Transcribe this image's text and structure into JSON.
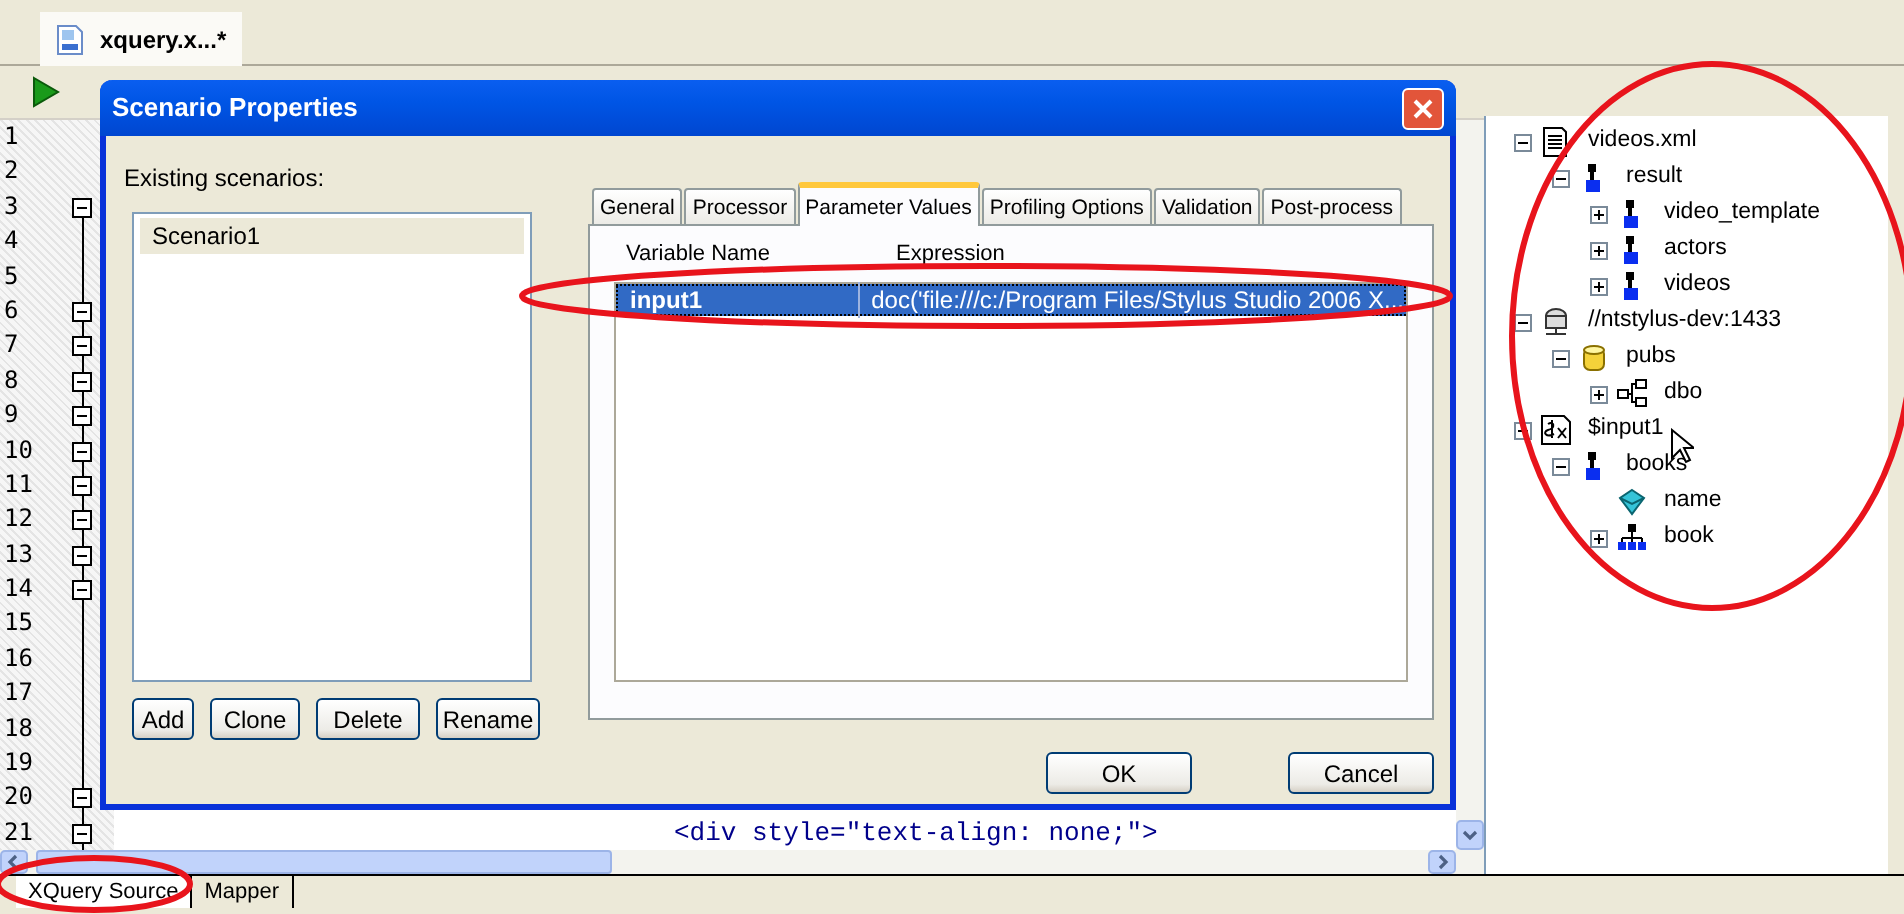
{
  "document_tab": {
    "label": "xquery.x...*",
    "selected": true
  },
  "gutter": [
    {
      "number": "1",
      "fold": false
    },
    {
      "number": "2",
      "fold": false
    },
    {
      "number": "3",
      "fold": true
    },
    {
      "number": "4",
      "fold": false
    },
    {
      "number": "5",
      "fold": false
    },
    {
      "number": "6",
      "fold": true
    },
    {
      "number": "7",
      "fold": true
    },
    {
      "number": "8",
      "fold": true
    },
    {
      "number": "9",
      "fold": true
    },
    {
      "number": "10",
      "fold": true
    },
    {
      "number": "11",
      "fold": true
    },
    {
      "number": "12",
      "fold": true
    },
    {
      "number": "13",
      "fold": true
    },
    {
      "number": "14",
      "fold": true
    },
    {
      "number": "15",
      "fold": false
    },
    {
      "number": "16",
      "fold": false
    },
    {
      "number": "17",
      "fold": false
    },
    {
      "number": "18",
      "fold": false
    },
    {
      "number": "19",
      "fold": false
    },
    {
      "number": "20",
      "fold": true
    },
    {
      "number": "21",
      "fold": true,
      "code": "<div style=\"text-align: none;\">"
    }
  ],
  "dialog": {
    "title": "Scenario Properties",
    "scenarios_label": "Existing scenarios:",
    "scenarios": [
      {
        "label": "Scenario1",
        "selected": true
      }
    ],
    "scenario_buttons": [
      "Add",
      "Clone",
      "Delete",
      "Rename"
    ],
    "tabs": [
      {
        "label": "General",
        "selected": false
      },
      {
        "label": "Processor",
        "selected": false
      },
      {
        "label": "Parameter Values",
        "selected": true
      },
      {
        "label": "Profiling Options",
        "selected": false
      },
      {
        "label": "Validation",
        "selected": false
      },
      {
        "label": "Post-process",
        "selected": false
      }
    ],
    "table": {
      "columns": [
        "Variable Name",
        "Expression"
      ],
      "rows": [
        {
          "cells": [
            "input1",
            "doc('file:///c:/Program Files/Stylus Studio 2006 X..."
          ],
          "selected": true
        }
      ]
    },
    "buttons": [
      "OK",
      "Cancel"
    ]
  },
  "tree": [
    {
      "label": "videos.xml",
      "kind": "file",
      "expanded": true,
      "children": [
        {
          "label": "result",
          "kind": "element",
          "expanded": true,
          "children": [
            {
              "label": "video_template",
              "kind": "element",
              "expanded": false
            },
            {
              "label": "actors",
              "kind": "element",
              "expanded": false
            },
            {
              "label": "videos",
              "kind": "element",
              "expanded": false
            }
          ]
        }
      ]
    },
    {
      "label": "//ntstylus-dev:1433",
      "kind": "server",
      "expanded": true,
      "children": [
        {
          "label": "pubs",
          "kind": "database",
          "expanded": true,
          "children": [
            {
              "label": "dbo",
              "kind": "schema",
              "expanded": false
            }
          ]
        }
      ]
    },
    {
      "label": "$input1",
      "kind": "variable",
      "expanded": true,
      "children": [
        {
          "label": "books",
          "kind": "element",
          "expanded": true,
          "children": [
            {
              "label": "name",
              "kind": "attribute"
            },
            {
              "label": "book",
              "kind": "group",
              "expanded": false
            }
          ]
        }
      ]
    }
  ],
  "bottom_tabs": [
    {
      "label": "XQuery Source",
      "selected": true
    },
    {
      "label": "Mapper",
      "selected": false
    }
  ]
}
